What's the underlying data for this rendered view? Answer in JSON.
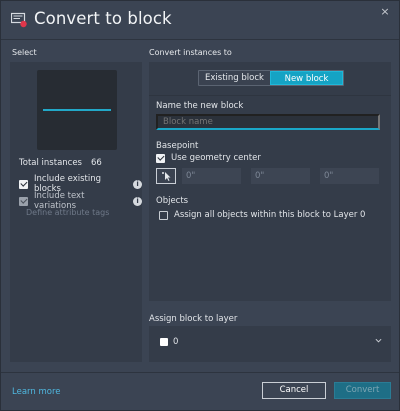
{
  "window": {
    "title": "Convert to block",
    "close_label": "×"
  },
  "select_panel": {
    "heading": "Select",
    "total_instances_label": "Total instances",
    "total_instances_value": "66",
    "include_existing_blocks": {
      "label": "Include existing blocks",
      "checked": true
    },
    "include_text_variations": {
      "label": "Include text variations",
      "checked": true,
      "disabled": true
    },
    "define_attribute_tags": "Define attribute tags",
    "info_glyph": "i"
  },
  "convert_panel": {
    "heading": "Convert instances to",
    "tabs": [
      {
        "label": "Existing block",
        "active": false
      },
      {
        "label": "New block",
        "active": true
      }
    ],
    "name_label": "Name the new block",
    "name_placeholder": "Block name",
    "basepoint_label": "Basepoint",
    "use_geometry_center": {
      "label": "Use geometry center",
      "checked": true
    },
    "coords": [
      "0\"",
      "0\"",
      "0\""
    ],
    "objects_label": "Objects",
    "assign_all_objects": {
      "label": "Assign all objects within this block to Layer 0",
      "checked": false
    }
  },
  "layer": {
    "heading": "Assign block to layer",
    "selected": "0",
    "swatch_color": "#ffffff"
  },
  "footer": {
    "learn_more": "Learn more",
    "cancel": "Cancel",
    "convert": "Convert"
  },
  "colors": {
    "accent": "#15a3c4",
    "link": "#4fb8e0",
    "preview_line": "#22a8c8"
  }
}
